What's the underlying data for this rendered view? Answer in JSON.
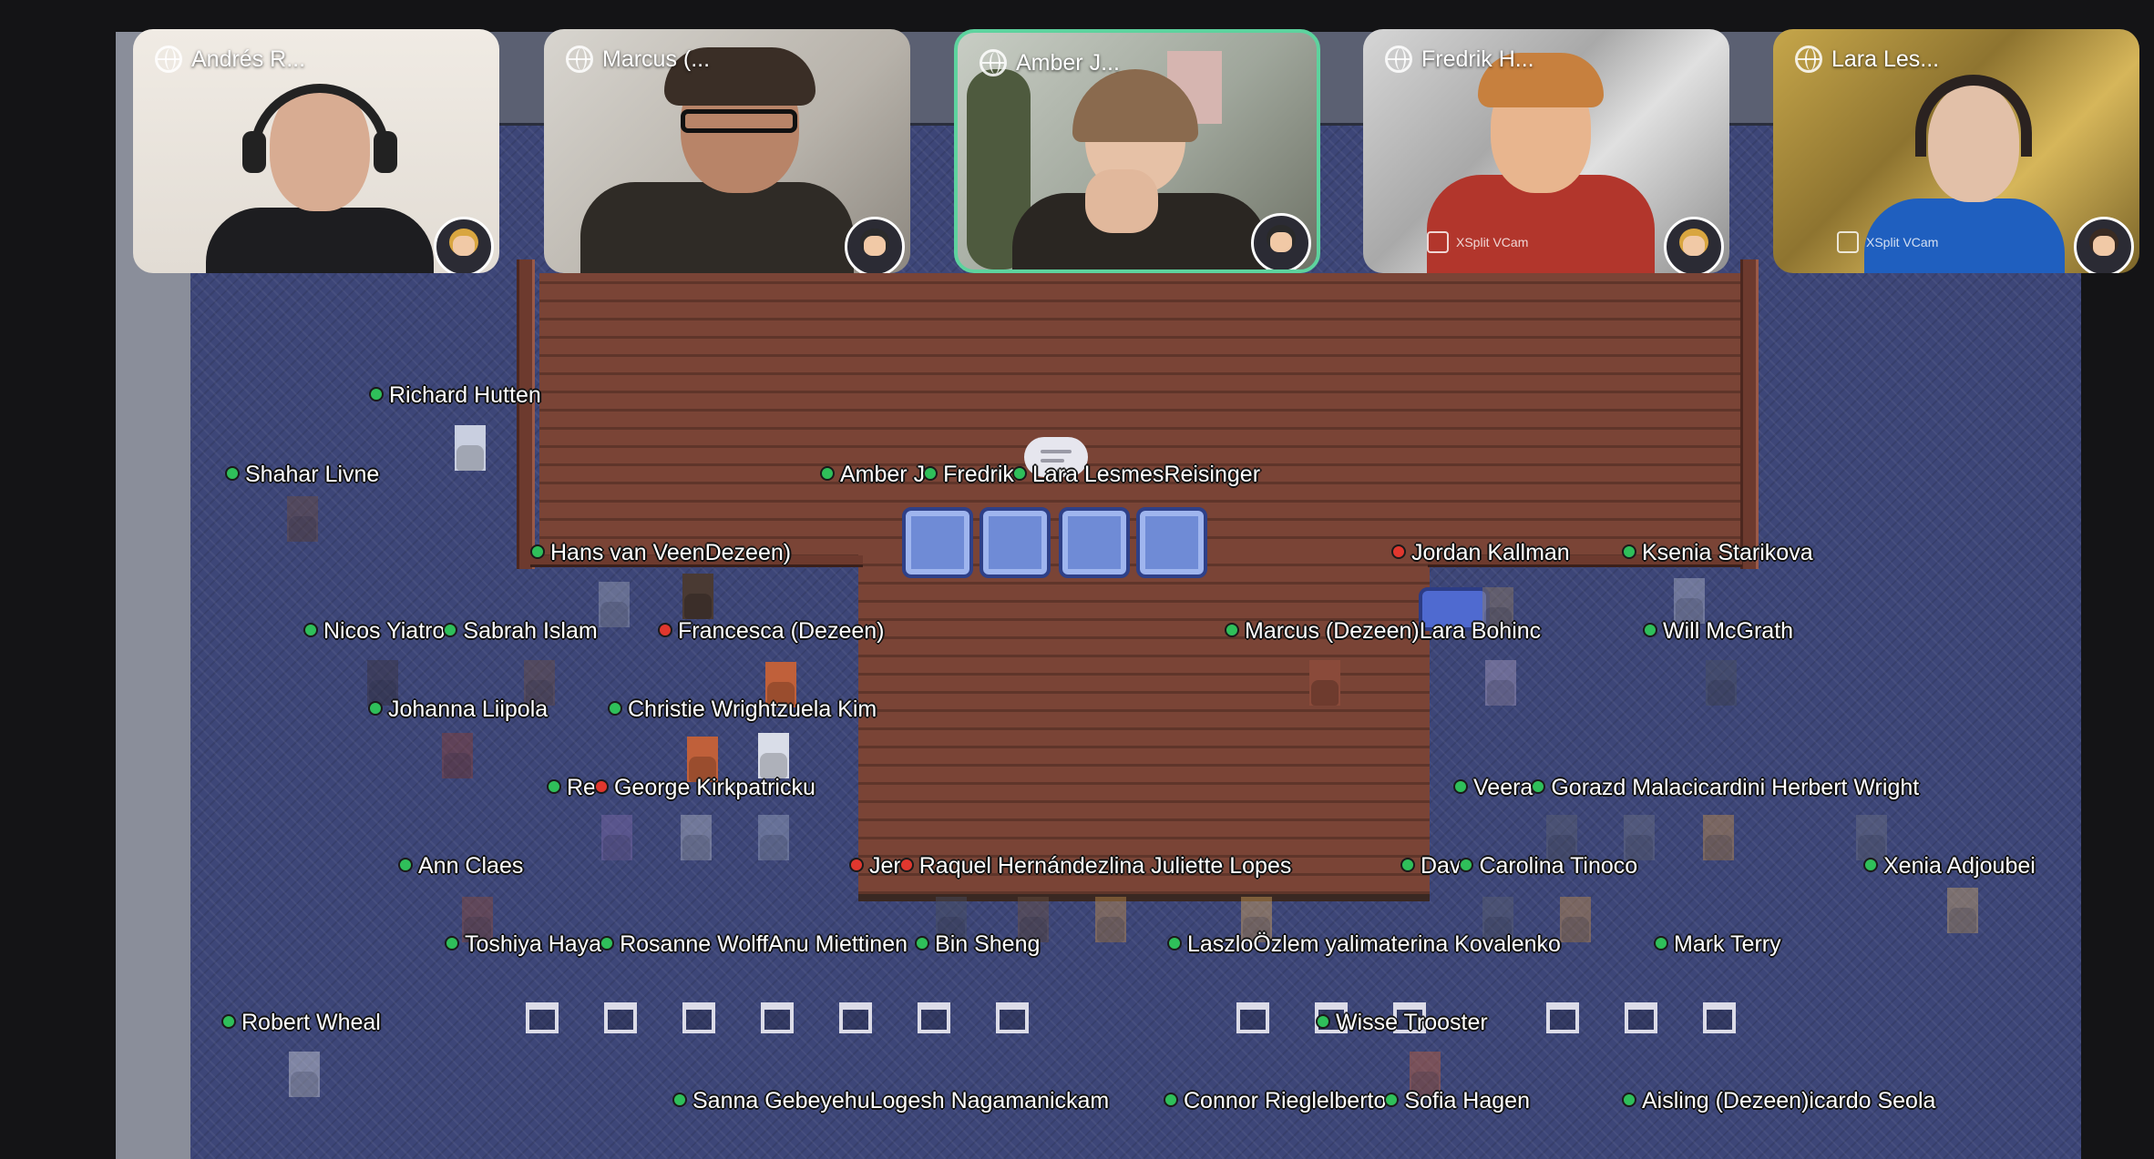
{
  "participants": [
    {
      "name": "Andrés R...",
      "speaking": false
    },
    {
      "name": "Marcus (...",
      "speaking": false
    },
    {
      "name": "Amber J...",
      "speaking": true
    },
    {
      "name": "Fredrik H...",
      "speaking": false,
      "vcam": "XSplit VCam"
    },
    {
      "name": "Lara Les...",
      "speaking": false,
      "vcam": "XSplit VCam"
    }
  ],
  "map_labels": [
    {
      "text": "Richard Hutten",
      "status": "green"
    },
    {
      "text": "Shahar Livne",
      "status": "green"
    },
    {
      "text": "Amber J",
      "status": "green"
    },
    {
      "text": "Fredrik",
      "status": "green"
    },
    {
      "text": "Lara Lesmes",
      "status": "green"
    },
    {
      "text": "Reisinger",
      "status": "none"
    },
    {
      "text": "Hans van Veen",
      "status": "green"
    },
    {
      "text": "Dezeen)",
      "status": "none"
    },
    {
      "text": "Jordan Kallman",
      "status": "red"
    },
    {
      "text": "Ksenia Starikova",
      "status": "green"
    },
    {
      "text": "Nicos Yiatro",
      "status": "green"
    },
    {
      "text": "Sabrah Islam",
      "status": "green"
    },
    {
      "text": "Francesca (Dezeen)",
      "status": "red"
    },
    {
      "text": "Marcus (Dezeen)",
      "status": "green"
    },
    {
      "text": "Lara Bohinc",
      "status": "none"
    },
    {
      "text": "Will McGrath",
      "status": "green"
    },
    {
      "text": "Johanna Liipola",
      "status": "green"
    },
    {
      "text": "Christie Wright",
      "status": "green"
    },
    {
      "text": "zuela Kim",
      "status": "none"
    },
    {
      "text": "Re",
      "status": "green"
    },
    {
      "text": "George Kirkpatrick",
      "status": "red"
    },
    {
      "text": "u",
      "status": "none"
    },
    {
      "text": "Veera",
      "status": "green"
    },
    {
      "text": "Gorazd Malacic",
      "status": "green"
    },
    {
      "text": "ardini Herbert Wright",
      "status": "none"
    },
    {
      "text": "Ann Claes",
      "status": "green"
    },
    {
      "text": "Jer",
      "status": "red"
    },
    {
      "text": "Raquel Hernández",
      "status": "red"
    },
    {
      "text": "lina Juliette Lopes",
      "status": "none"
    },
    {
      "text": "Dav",
      "status": "green"
    },
    {
      "text": "Carolina Tinoco",
      "status": "green"
    },
    {
      "text": "Xenia Adjoubei",
      "status": "green"
    },
    {
      "text": "Toshiya Haya",
      "status": "green"
    },
    {
      "text": "Rosanne Wolff",
      "status": "green"
    },
    {
      "text": "Anu Miettinen",
      "status": "none"
    },
    {
      "text": "Bin Sheng",
      "status": "green"
    },
    {
      "text": "Laszlo",
      "status": "green"
    },
    {
      "text": "Özlem yalim",
      "status": "none"
    },
    {
      "text": "aterina Kovalenko",
      "status": "none"
    },
    {
      "text": "Mark Terry",
      "status": "green"
    },
    {
      "text": "Robert Wheal",
      "status": "green"
    },
    {
      "text": "Wisse Trooster",
      "status": "green"
    },
    {
      "text": "Sanna Gebeyehu",
      "status": "green"
    },
    {
      "text": "Logesh Nagamanickam",
      "status": "none"
    },
    {
      "text": "Connor Riegle",
      "status": "green"
    },
    {
      "text": "lberto",
      "status": "none"
    },
    {
      "text": "Sofia Hagen",
      "status": "green"
    },
    {
      "text": "Aisling (Dezeen)",
      "status": "green"
    },
    {
      "text": "icardo Seola",
      "status": "none"
    }
  ],
  "colors": {
    "status_green": "#2fbf5a",
    "status_red": "#e0372e",
    "speaking_border": "#5dd39e",
    "floor": "#3d4678",
    "stage_wood": "#7a4436"
  }
}
